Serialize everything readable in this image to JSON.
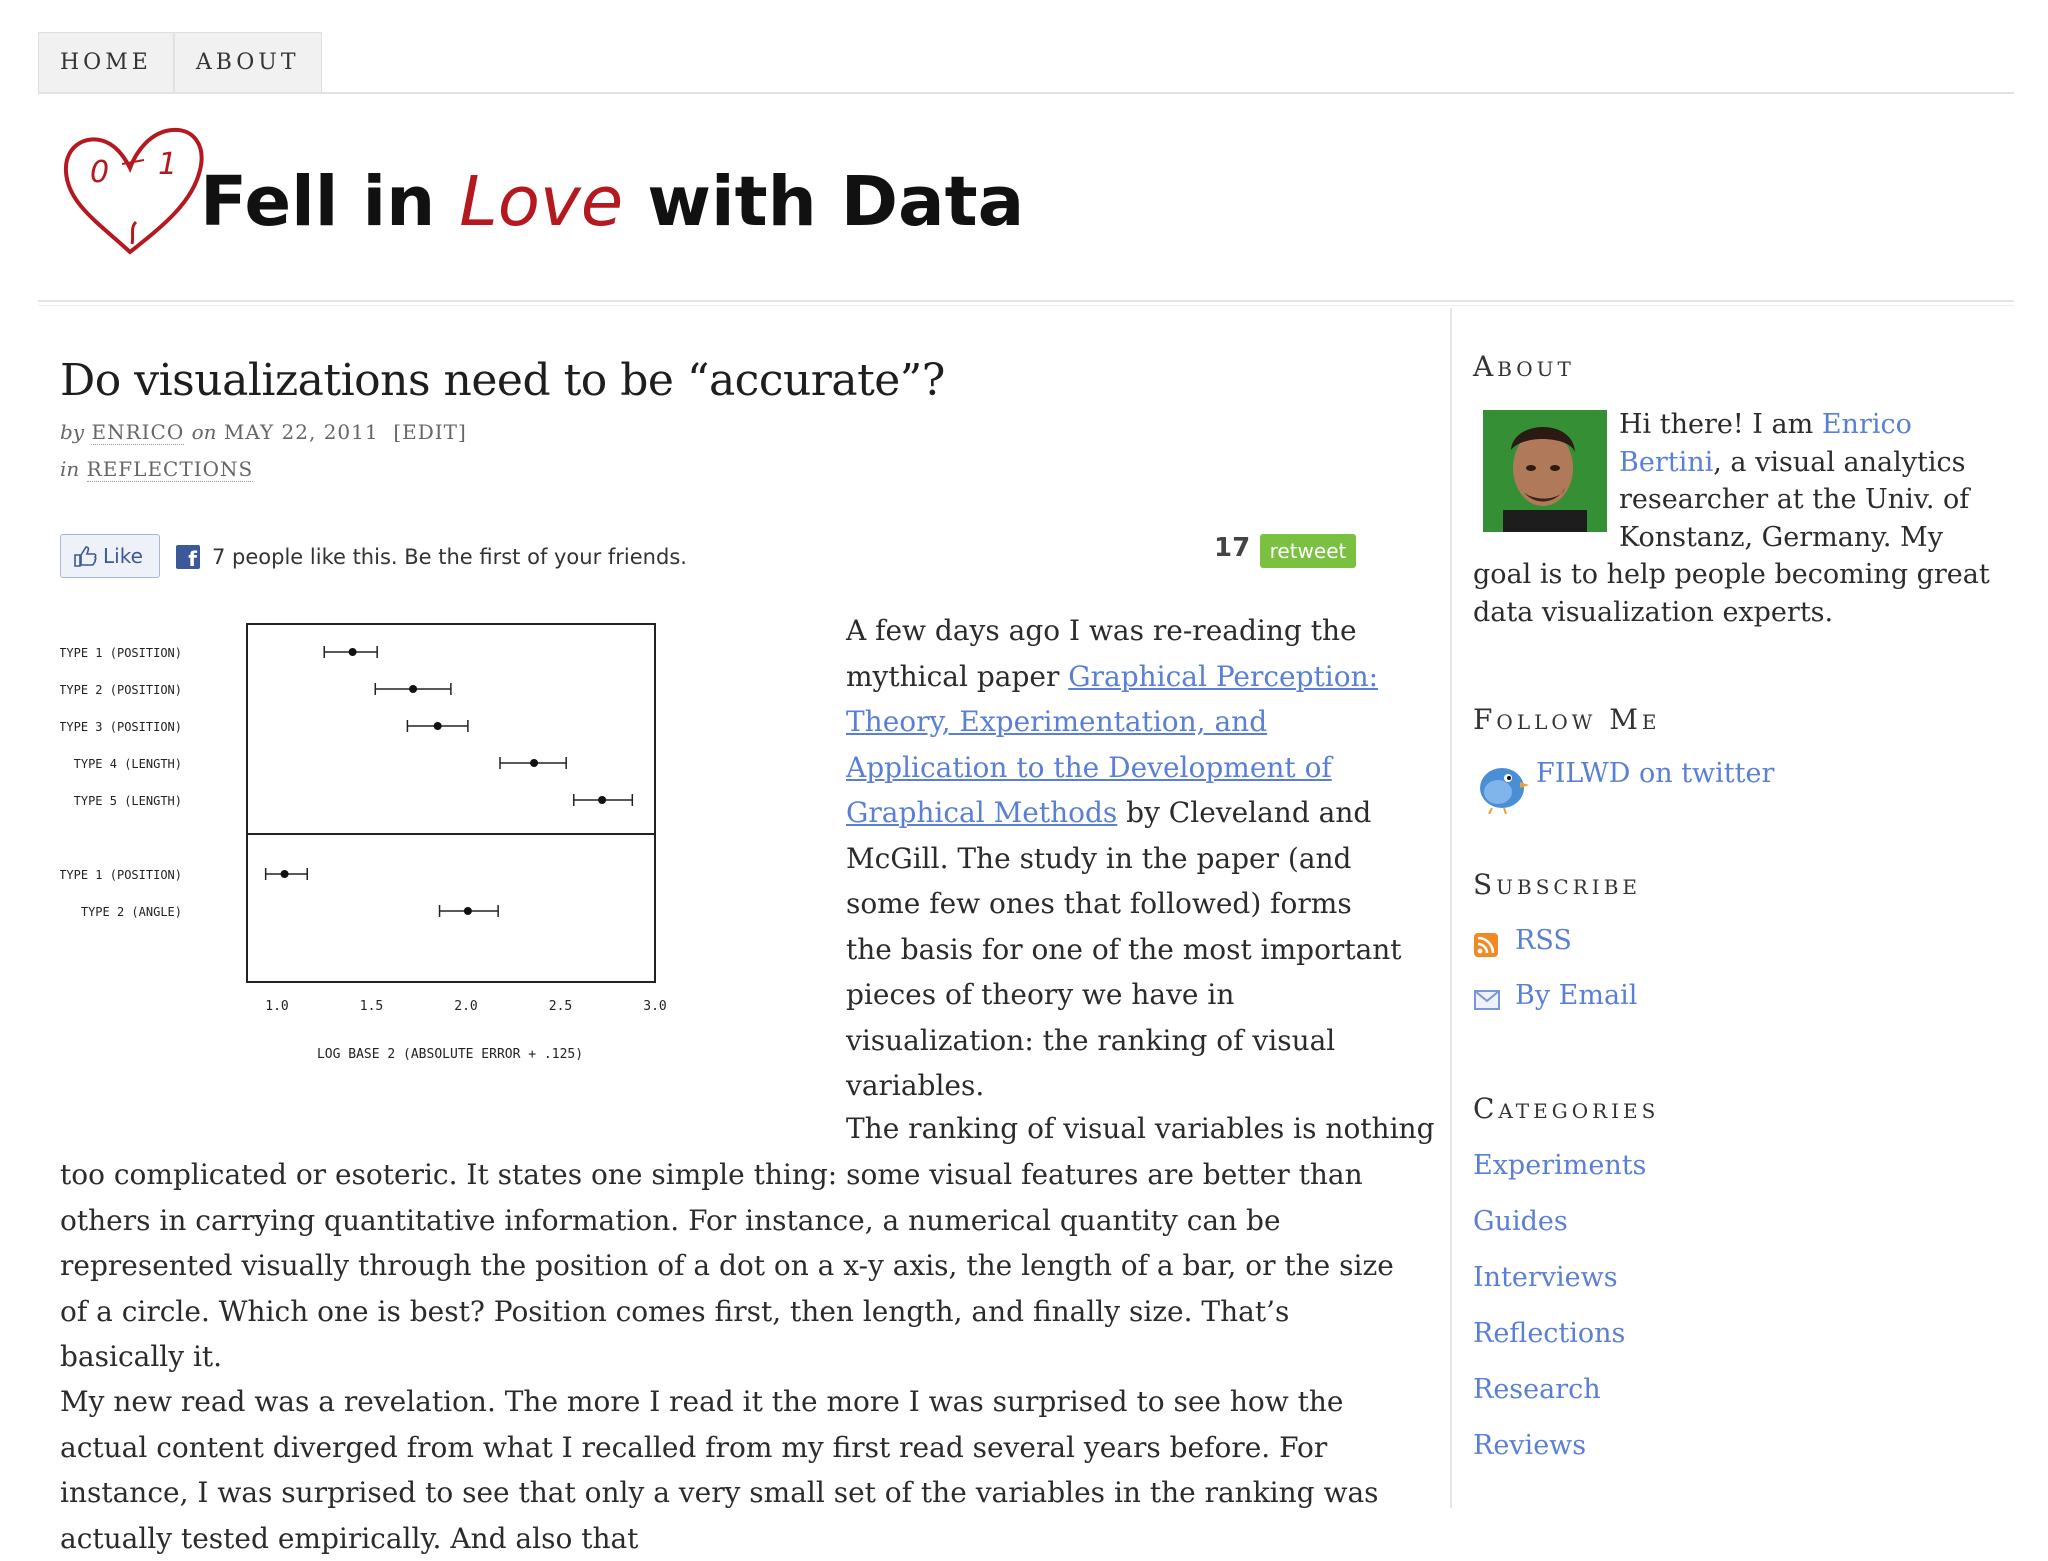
{
  "nav": {
    "items": [
      {
        "label": "HOME"
      },
      {
        "label": "ABOUT"
      }
    ]
  },
  "header": {
    "logo_digits": [
      "0",
      "1"
    ],
    "title_part1": "Fell in ",
    "title_love": "Love",
    "title_part2": " with Data"
  },
  "post": {
    "title": "Do visualizations need to be “accurate”?",
    "meta": {
      "by_prefix": "by",
      "author": "ENRICO",
      "on_prefix": "on",
      "date": "MAY 22, 2011",
      "edit": "[EDIT]",
      "in_prefix": "in",
      "category": "REFLECTIONS"
    },
    "social": {
      "like_label": "Like",
      "fb_text": "7 people like this. Be the first of your friends.",
      "retweet_count": "17",
      "retweet_label": "retweet"
    },
    "intro_before_link": "A few days ago I was re-reading the mythical paper ",
    "intro_link": "Graphical Perception: Theory, Experimentation, and Application to the Development of Graphical Methods",
    "intro_after_link": " by Cleveland and McGill. The study in the paper (and some few ones that followed) forms the basis for one of the most important pieces of theory we have in visualization: the ranking of visual variables.",
    "para2_start": "The ranking of visual variables is nothing",
    "para2": "too complicated or esoteric. It states one simple thing: some visual features are better than others in carrying quantitative information. For instance, a numerical quantity can be represented visually through the position of a dot on a x-y axis, the length of a bar, or the size of a circle. Which one is best? Position comes first, then length, and finally size. That’s basically it.",
    "para3": "My new read was a revelation. The more I read it the more I was surprised to see how the actual content diverged from what I recalled from my first read several years before. For instance, I was surprised to see that only a very small set of the variables in the ranking was actually tested empirically. And also that"
  },
  "chart_data": {
    "type": "scatter",
    "xlabel": "LOG BASE 2 (ABSOLUTE ERROR + .125)",
    "xlim": [
      1.0,
      3.0
    ],
    "xticks": [
      "1.0",
      "1.5",
      "2.0",
      "2.5",
      "3.0"
    ],
    "panels": [
      {
        "rows": [
          {
            "label": "TYPE 1 (POSITION)",
            "value": 1.4,
            "low": 1.25,
            "high": 1.53
          },
          {
            "label": "TYPE 2 (POSITION)",
            "value": 1.72,
            "low": 1.52,
            "high": 1.92
          },
          {
            "label": "TYPE 3 (POSITION)",
            "value": 1.85,
            "low": 1.69,
            "high": 2.01
          },
          {
            "label": "TYPE 4 (LENGTH)",
            "value": 2.36,
            "low": 2.18,
            "high": 2.53
          },
          {
            "label": "TYPE 5 (LENGTH)",
            "value": 2.72,
            "low": 2.57,
            "high": 2.88
          }
        ]
      },
      {
        "rows": [
          {
            "label": "TYPE 1 (POSITION)",
            "value": 1.04,
            "low": 0.94,
            "high": 1.16
          },
          {
            "label": "TYPE 2 (ANGLE)",
            "value": 2.01,
            "low": 1.86,
            "high": 2.17
          }
        ]
      }
    ]
  },
  "sidebar": {
    "about": {
      "title": "About",
      "text_before": "Hi there! I am ",
      "name_link": "Enrico Bertini",
      "text_after": ", a visual analytics researcher at the Univ. of Konstanz, Germany. My goal is to help people becoming great data visualization experts."
    },
    "follow": {
      "title": "Follow Me",
      "twitter_link": "FILWD on twitter"
    },
    "subscribe": {
      "title": "Subscribe",
      "rss": "RSS",
      "email": "By Email"
    },
    "categories": {
      "title": "Categories",
      "items": [
        "Experiments",
        "Guides",
        "Interviews",
        "Reflections",
        "Research",
        "Reviews"
      ]
    }
  },
  "colors": {
    "link": "#5a7fd6",
    "love_red": "#b5181f",
    "retweet_green": "#7ac142",
    "facebook_blue": "#3b5998"
  },
  "icons": [
    "heart-logo-icon",
    "thumbs-up-icon",
    "facebook-icon",
    "twitter-bird-icon",
    "rss-icon",
    "email-icon"
  ]
}
